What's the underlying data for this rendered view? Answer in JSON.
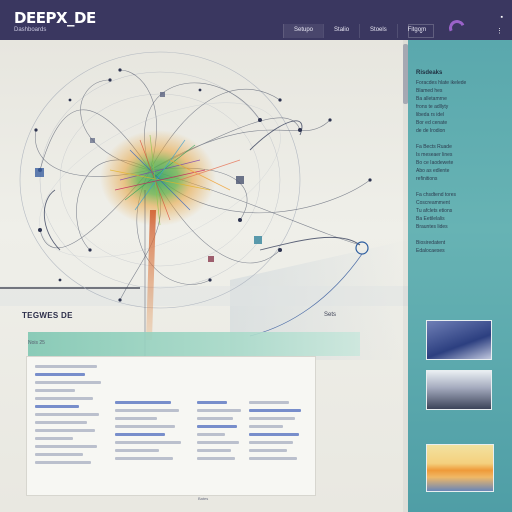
{
  "app": {
    "logo": "DEEPX_DE",
    "subtitle": "Dashboards"
  },
  "nav": {
    "items": [
      {
        "label": "Setupo"
      },
      {
        "label": "Stalio"
      },
      {
        "label": "Stoels"
      },
      {
        "label": "Fitgom"
      }
    ],
    "dropdown_label": "⌄"
  },
  "window_controls": {
    "minimize": "▪",
    "close": "⋮"
  },
  "main": {
    "section_title": "TEGWES DE",
    "section_subtitle": "Nois 25",
    "section_tag": "Sets"
  },
  "doc": {
    "footer": "Bates"
  },
  "panel": {
    "heading": "Risdeaks",
    "blocks": [
      "Foracdes hlate ikelede\nBlamed hes\nBa alletamrne\nfrons te adllyty\nlibeda rs idel\nBor ed cenate\nde de Irodion",
      "Fa Bects Ruade\nIs meseaer lines\nBo ce Iaodewete\nAbo as edlente\nrefinitions",
      "Fa chsdtend tores\nCoscreamment\nTu afclets etions\nBa Eetilelalis\nBrauntes lides",
      "Biosiredatent\nEdalocaeses"
    ]
  },
  "colors": {
    "header": "#3a3760",
    "panel": "#5aa8ad",
    "accent_teal": "#7fc7b2",
    "accent_purple": "#9a63c9"
  },
  "icons": {
    "nav_dropdown": "chevron-down-icon",
    "network_node": "ring-node-icon"
  }
}
